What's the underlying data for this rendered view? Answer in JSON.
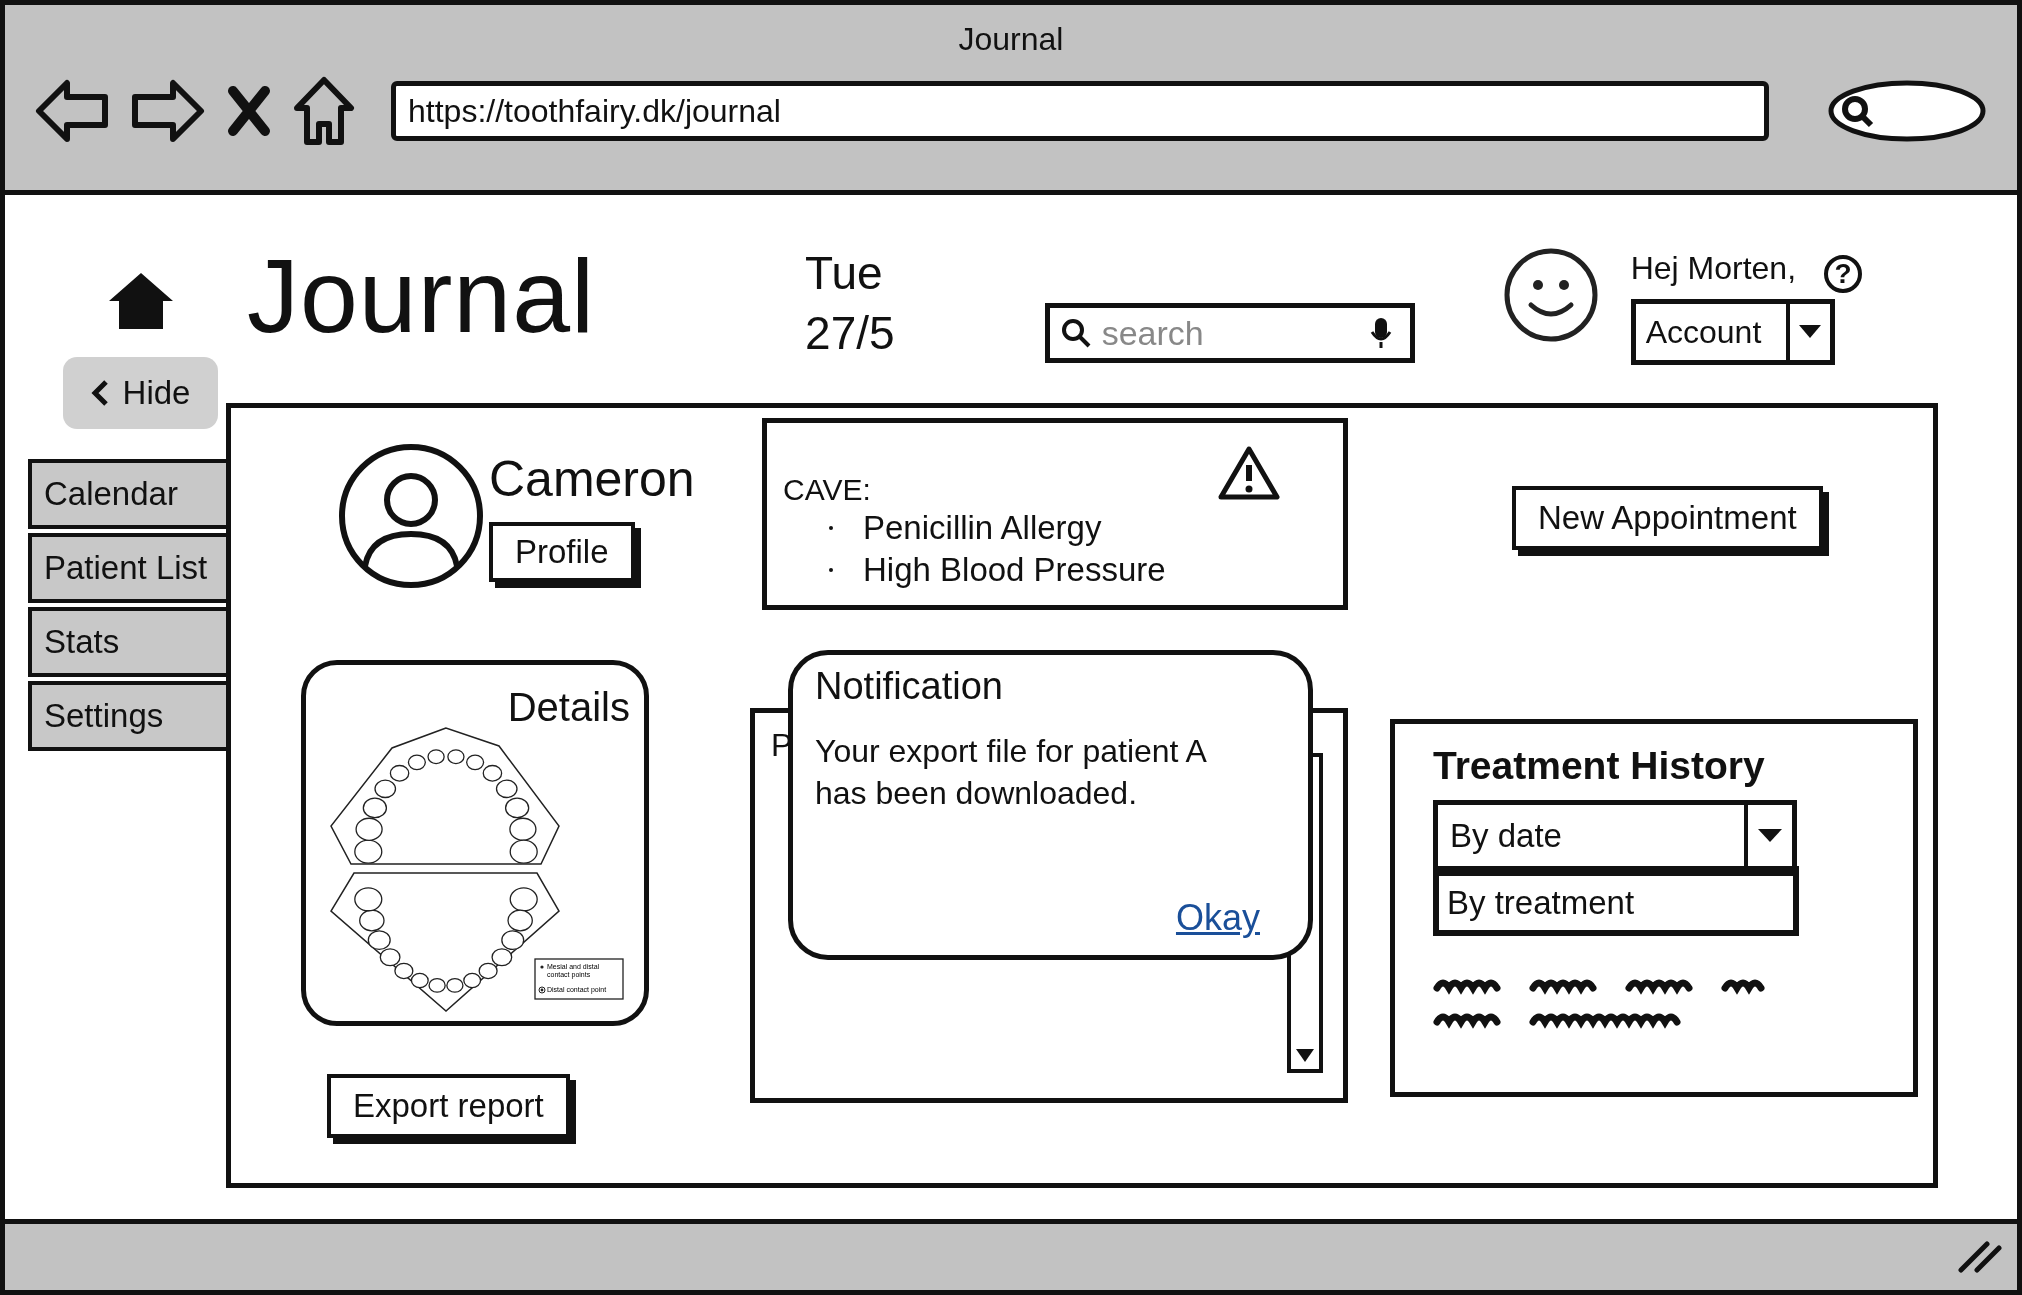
{
  "window": {
    "title": "Journal"
  },
  "browser": {
    "url": "https://toothfairy.dk/journal"
  },
  "header": {
    "title": "Journal",
    "day": "Tue",
    "date": "27/5",
    "search": {
      "placeholder": "search"
    },
    "greeting": "Hej Morten,",
    "help": "?",
    "account": {
      "value": "Account"
    }
  },
  "hide_button": {
    "label": "Hide"
  },
  "sidebar": {
    "items": [
      {
        "label": "Calendar"
      },
      {
        "label": "Patient List"
      },
      {
        "label": "Stats"
      },
      {
        "label": "Settings"
      }
    ]
  },
  "patient": {
    "name": "Cameron",
    "profile_button": "Profile"
  },
  "cave": {
    "title": "CAVE:",
    "items": [
      "Penicillin Allergy",
      "High Blood Pressure"
    ]
  },
  "new_appointment_button": "New Appointment",
  "details": {
    "title": "Details",
    "legend": [
      "Mesial and distal",
      "contact points",
      "Distal contact point"
    ]
  },
  "export_button": "Export report",
  "hidden_panel": {
    "title": "P"
  },
  "notification": {
    "title": "Notification",
    "message": "Your export file for patient A has been downloaded.",
    "link": "Okay"
  },
  "treatment_history": {
    "title": "Treatment History",
    "sort": {
      "value": "By date",
      "expanded": true,
      "options": [
        "By treatment"
      ]
    }
  }
}
